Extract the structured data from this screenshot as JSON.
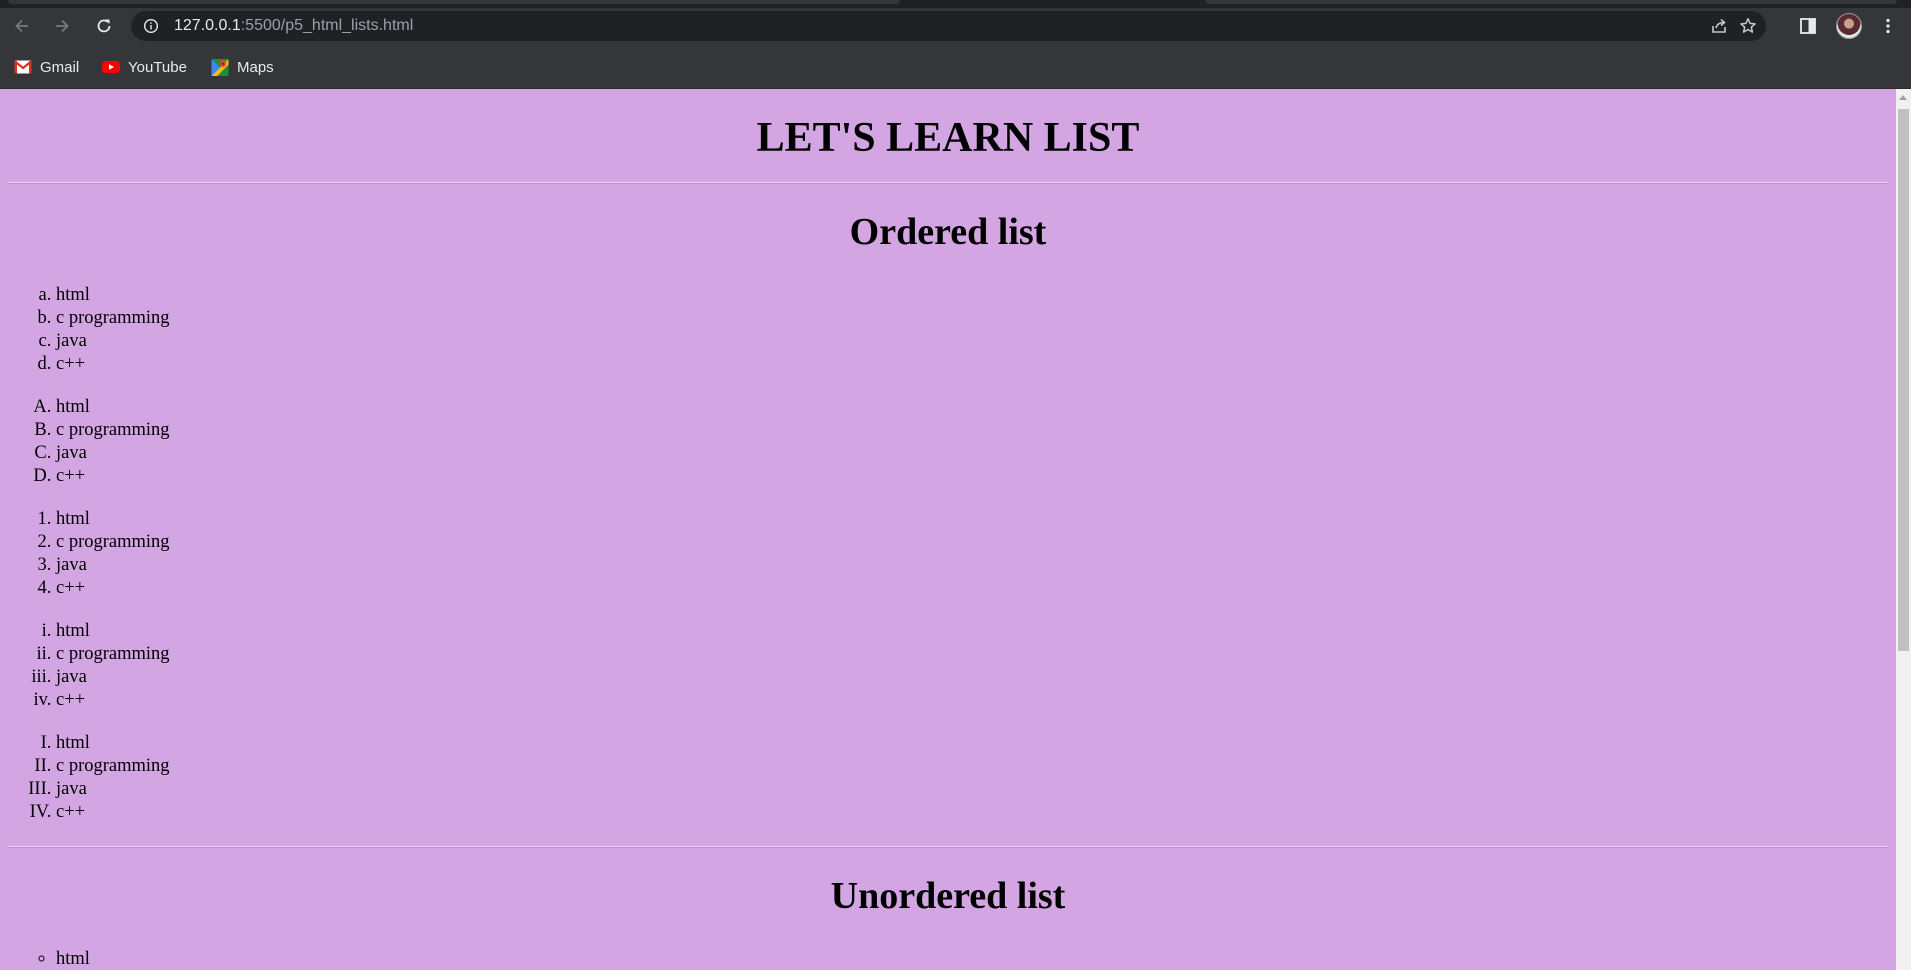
{
  "browser": {
    "url_host": "127.0.0.1",
    "url_rest": ":5500/p5_html_lists.html"
  },
  "bookmarks": [
    {
      "label": "Gmail",
      "icon": "gmail-icon"
    },
    {
      "label": "YouTube",
      "icon": "youtube-icon"
    },
    {
      "label": "Maps",
      "icon": "maps-icon"
    }
  ],
  "colors": {
    "page_background": "#d3a6e3",
    "toolbar": "#35363a",
    "omnibox": "#202124"
  },
  "page": {
    "title": "LET'S LEARN LIST",
    "ordered_heading": "Ordered list",
    "unordered_heading": "Unordered list",
    "items": [
      "html",
      "c programming",
      "java",
      "c++"
    ],
    "ordered_list_types": [
      "a",
      "A",
      "1",
      "i",
      "I"
    ],
    "unordered_first_item": "html"
  }
}
